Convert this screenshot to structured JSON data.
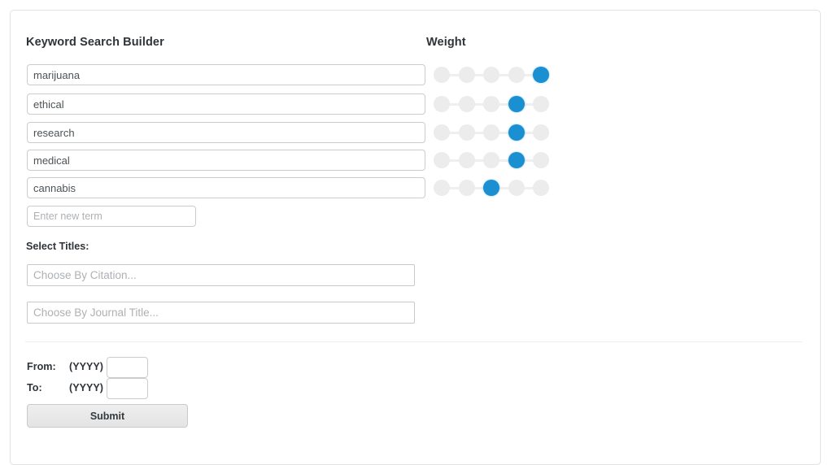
{
  "card": {
    "keyword_section_title": "Keyword Search Builder",
    "weight_section_title": "Weight"
  },
  "keywords": [
    {
      "value": "marijuana",
      "placeholder": "",
      "weight": 5
    },
    {
      "value": "ethical",
      "placeholder": "",
      "weight": 4
    },
    {
      "value": "research",
      "placeholder": "",
      "weight": 4
    },
    {
      "value": "medical",
      "placeholder": "",
      "weight": 4
    },
    {
      "value": "cannabis",
      "placeholder": "",
      "weight": 3
    }
  ],
  "new_term": {
    "value": "",
    "placeholder": "Enter new term"
  },
  "slider": {
    "steps": 5,
    "active_color": "#1a8fd1",
    "inactive_color": "#ececec",
    "track_color": "#efefef"
  },
  "select_titles": {
    "label": "Select Titles:",
    "citation": {
      "value": "",
      "placeholder": "Choose By Citation..."
    },
    "journal": {
      "value": "",
      "placeholder": "Choose By Journal Title..."
    }
  },
  "date_range": {
    "from": {
      "label": "From:",
      "format": "(YYYY)",
      "value": ""
    },
    "to": {
      "label": "To:",
      "format": "(YYYY)",
      "value": ""
    }
  },
  "submit": {
    "label": "Submit"
  }
}
